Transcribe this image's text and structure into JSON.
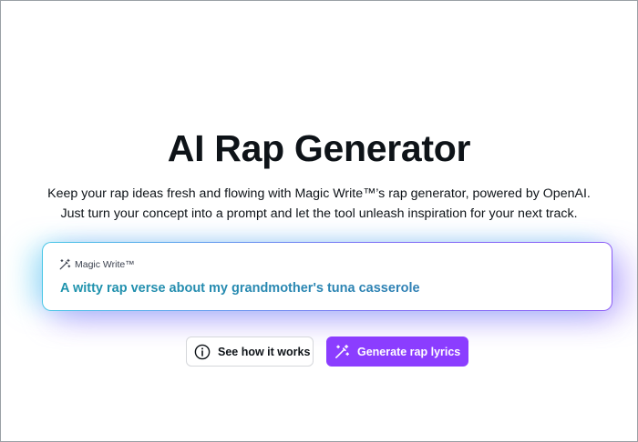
{
  "hero": {
    "title": "AI Rap Generator",
    "subtitle_line1": "Keep your rap ideas fresh and flowing with Magic Write™’s rap generator, powered by OpenAI.",
    "subtitle_line2": "Just turn your concept into a prompt and let the tool unleash inspiration for your next track."
  },
  "prompt_card": {
    "label": "Magic Write™",
    "label_icon": "magic-wand-icon",
    "text": "A witty rap verse about my grandmother's tuna casserole"
  },
  "actions": {
    "secondary_label": "See how it works",
    "secondary_icon": "info-icon",
    "primary_label": "Generate rap lyrics",
    "primary_icon": "magic-wand-icon"
  },
  "colors": {
    "primary_button": "#8b3dff",
    "prompt_text": "#1f8fa8",
    "title": "#0e1318",
    "card_border_start": "#46c6e6",
    "card_border_end": "#8b5cf6"
  }
}
